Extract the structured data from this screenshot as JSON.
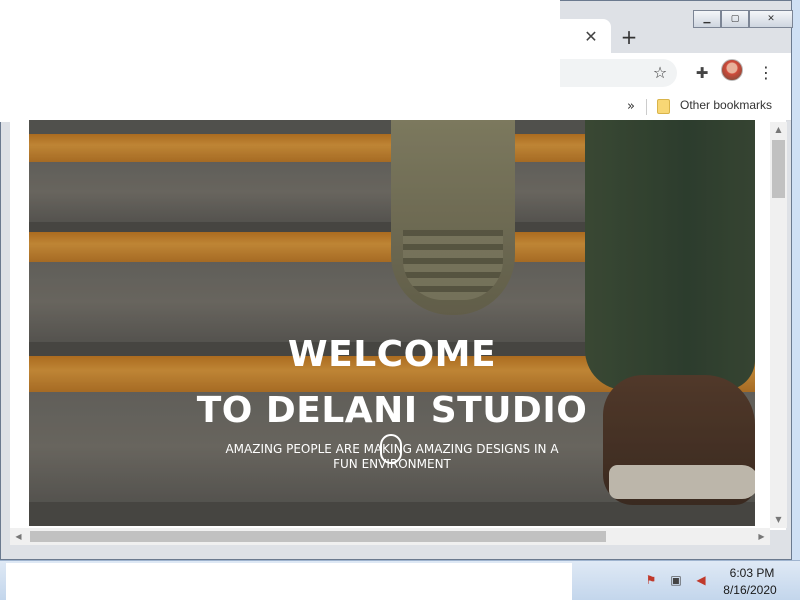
{
  "browser": {
    "tab_close_glyph": "✕",
    "new_tab_glyph": "+",
    "window_controls": {
      "minimize": "▁",
      "maximize": "▢",
      "close": "✕"
    },
    "icons": {
      "star": "star-icon",
      "extensions": "puzzle-icon",
      "menu": "kebab-menu-icon"
    }
  },
  "bookmarks_bar": {
    "overflow_glyph": "»",
    "other_bookmarks_label": "Other bookmarks"
  },
  "hero": {
    "title_line1": "WELCOME",
    "title_line2": "TO DELANI STUDIO",
    "subtitle": "AMAZING PEOPLE ARE MAKING AMAZING DESIGNS IN A FUN ENVIRONMENT"
  },
  "scrollbars": {
    "up": "▲",
    "down": "▼",
    "left": "◀",
    "right": "▶"
  },
  "taskbar": {
    "clock_time": "6:03 PM",
    "clock_date": "8/16/2020"
  },
  "colors": {
    "accent_orange": "#e09a3a",
    "hero_text": "#ffffff"
  }
}
